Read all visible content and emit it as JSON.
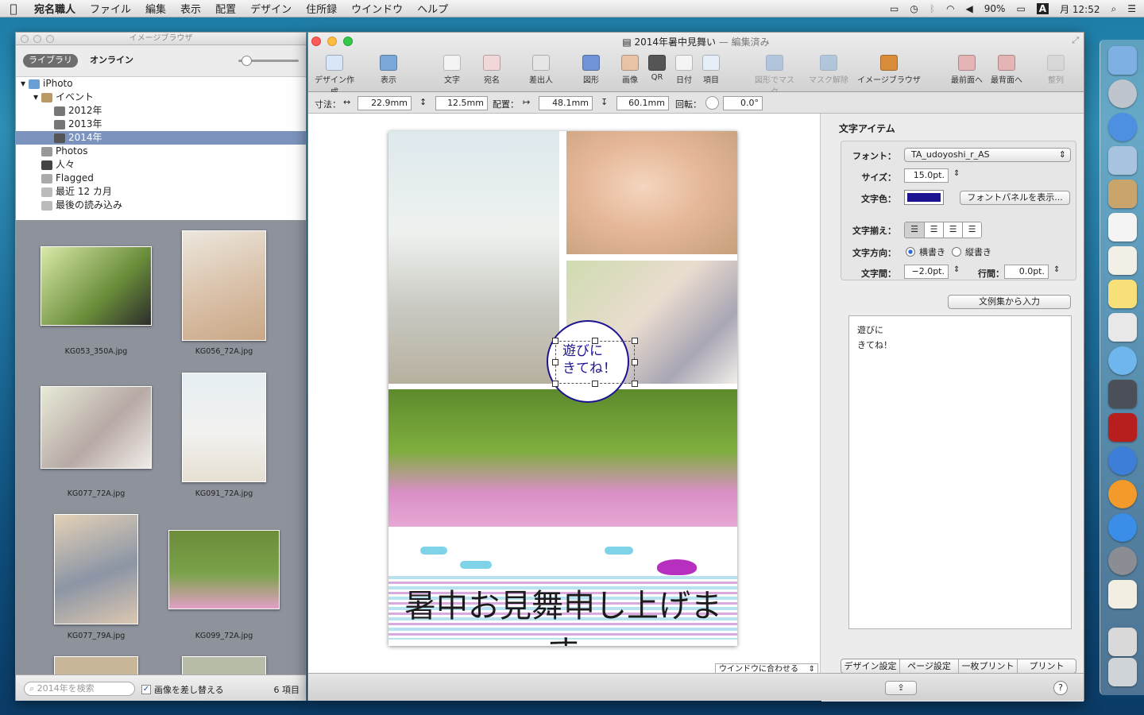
{
  "menubar": {
    "items": [
      "宛名職人",
      "ファイル",
      "編集",
      "表示",
      "配置",
      "デザイン",
      "住所録",
      "ウインドウ",
      "ヘルプ"
    ],
    "battery": "90%",
    "input": "A",
    "clock": "月 12:52"
  },
  "browser": {
    "title": "イメージブラウザ",
    "tab_library": "ライブラリ",
    "tab_online": "オンライン",
    "tree": [
      {
        "label": "iPhoto"
      },
      {
        "label": "イベント"
      },
      {
        "label": "2012年"
      },
      {
        "label": "2013年"
      },
      {
        "label": "2014年"
      },
      {
        "label": "Photos"
      },
      {
        "label": "人々"
      },
      {
        "label": "Flagged"
      },
      {
        "label": "最近 12 カ月"
      },
      {
        "label": "最後の読み込み"
      }
    ],
    "thumbs": [
      "KG053_350A.jpg",
      "KG056_72A.jpg",
      "KG077_72A.jpg",
      "KG091_72A.jpg",
      "KG077_79A.jpg",
      "KG099_72A.jpg"
    ],
    "search_placeholder": "2014年を検索",
    "replace_label": "画像を差し替える",
    "count": "6 項目"
  },
  "window": {
    "title": "2014年暑中見舞い",
    "title_suffix": "— 編集済み"
  },
  "toolbar": [
    {
      "label": "デザイン作成",
      "color": "#d8e6f7"
    },
    {
      "label": "表示",
      "color": "#7aa7d8"
    },
    {
      "label": "文字",
      "color": "#f3f3f3"
    },
    {
      "label": "宛名",
      "color": "#f1d7d7"
    },
    {
      "label": "差出人",
      "color": "#e6e6e6"
    },
    {
      "label": "図形",
      "color": "#6f93d6"
    },
    {
      "label": "画像",
      "color": "#e9c3a8"
    },
    {
      "label": "QR",
      "color": "#555555"
    },
    {
      "label": "日付",
      "color": "#f4f4f4"
    },
    {
      "label": "項目",
      "color": "#e6eef8"
    },
    {
      "label": "図形でマスク",
      "color": "#7aa7d8"
    },
    {
      "label": "マスク解除",
      "color": "#7aa7d8"
    },
    {
      "label": "イメージブラウザ",
      "color": "#d98c3a"
    },
    {
      "label": "最前面へ",
      "color": "#e5b4b4"
    },
    {
      "label": "最背面へ",
      "color": "#e5b4b4"
    },
    {
      "label": "整列",
      "color": "#d0d0d0"
    }
  ],
  "dims": {
    "size_label": "寸法：",
    "w": "22.9mm",
    "h": "12.5mm",
    "pos_label": "配置：",
    "x": "48.1mm",
    "y": "60.1mm",
    "rot_label": "回転：",
    "rot": "0.0°"
  },
  "card": {
    "bubble": [
      "遊びに",
      "きてね！"
    ],
    "banner": "暑中お見舞申し上げます"
  },
  "zoom": "ウインドウに合わせる",
  "inspector": {
    "title": "文字アイテム",
    "font_label": "フォント：",
    "font": "TA_udoyoshi_r_AS",
    "size_label": "サイズ：",
    "size": "15.0pt.",
    "color_label": "文字色：",
    "text_color": "#1d1491",
    "font_panel": "フォントパネルを表示...",
    "align_label": "文字揃え：",
    "dir_label": "文字方向：",
    "dir_h": "横書き",
    "dir_v": "縦書き",
    "spacing_label": "文字間：",
    "spacing": "−2.0pt.",
    "leading_label": "行間：",
    "leading": "0.0pt.",
    "samples": "文例集から入力",
    "text_lines": [
      "遊びに",
      "きてね！"
    ]
  },
  "bottom_tabs": [
    "デザイン設定",
    "ページ設定",
    "一枚プリント",
    "プリント"
  ]
}
